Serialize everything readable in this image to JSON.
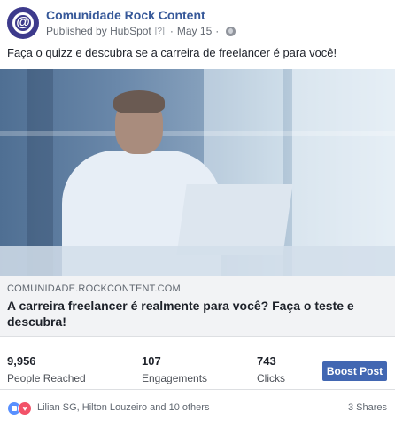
{
  "post": {
    "page_name": "Comunidade Rock Content",
    "published_by_prefix": "Published by",
    "publisher": "HubSpot",
    "help_marker": "[?]",
    "separator": "·",
    "date": "May 15",
    "message": "Faça o quizz e descubra se a carreira de freelancer é para você!"
  },
  "link_preview": {
    "domain": "COMUNIDADE.ROCKCONTENT.COM",
    "title": "A carreira freelancer é realmente para você? Faça o teste e descubra!"
  },
  "insights": {
    "reached_value": "9,956",
    "reached_label": "People Reached",
    "engagements_value": "107",
    "engagements_label": "Engagements",
    "clicks_value": "743",
    "clicks_label": "Clicks",
    "boost_label": "Boost Post"
  },
  "reactions": {
    "names": "Lilian SG, Hilton Louzeiro and 10 others",
    "shares": "3 Shares",
    "avatar_glyph": "@",
    "love_glyph": "♥"
  },
  "colors": {
    "page_link": "#365899",
    "avatar_bg": "#3d3a8c",
    "boost_button": "#4267b2",
    "like": "#5890ff",
    "love": "#f25268"
  }
}
